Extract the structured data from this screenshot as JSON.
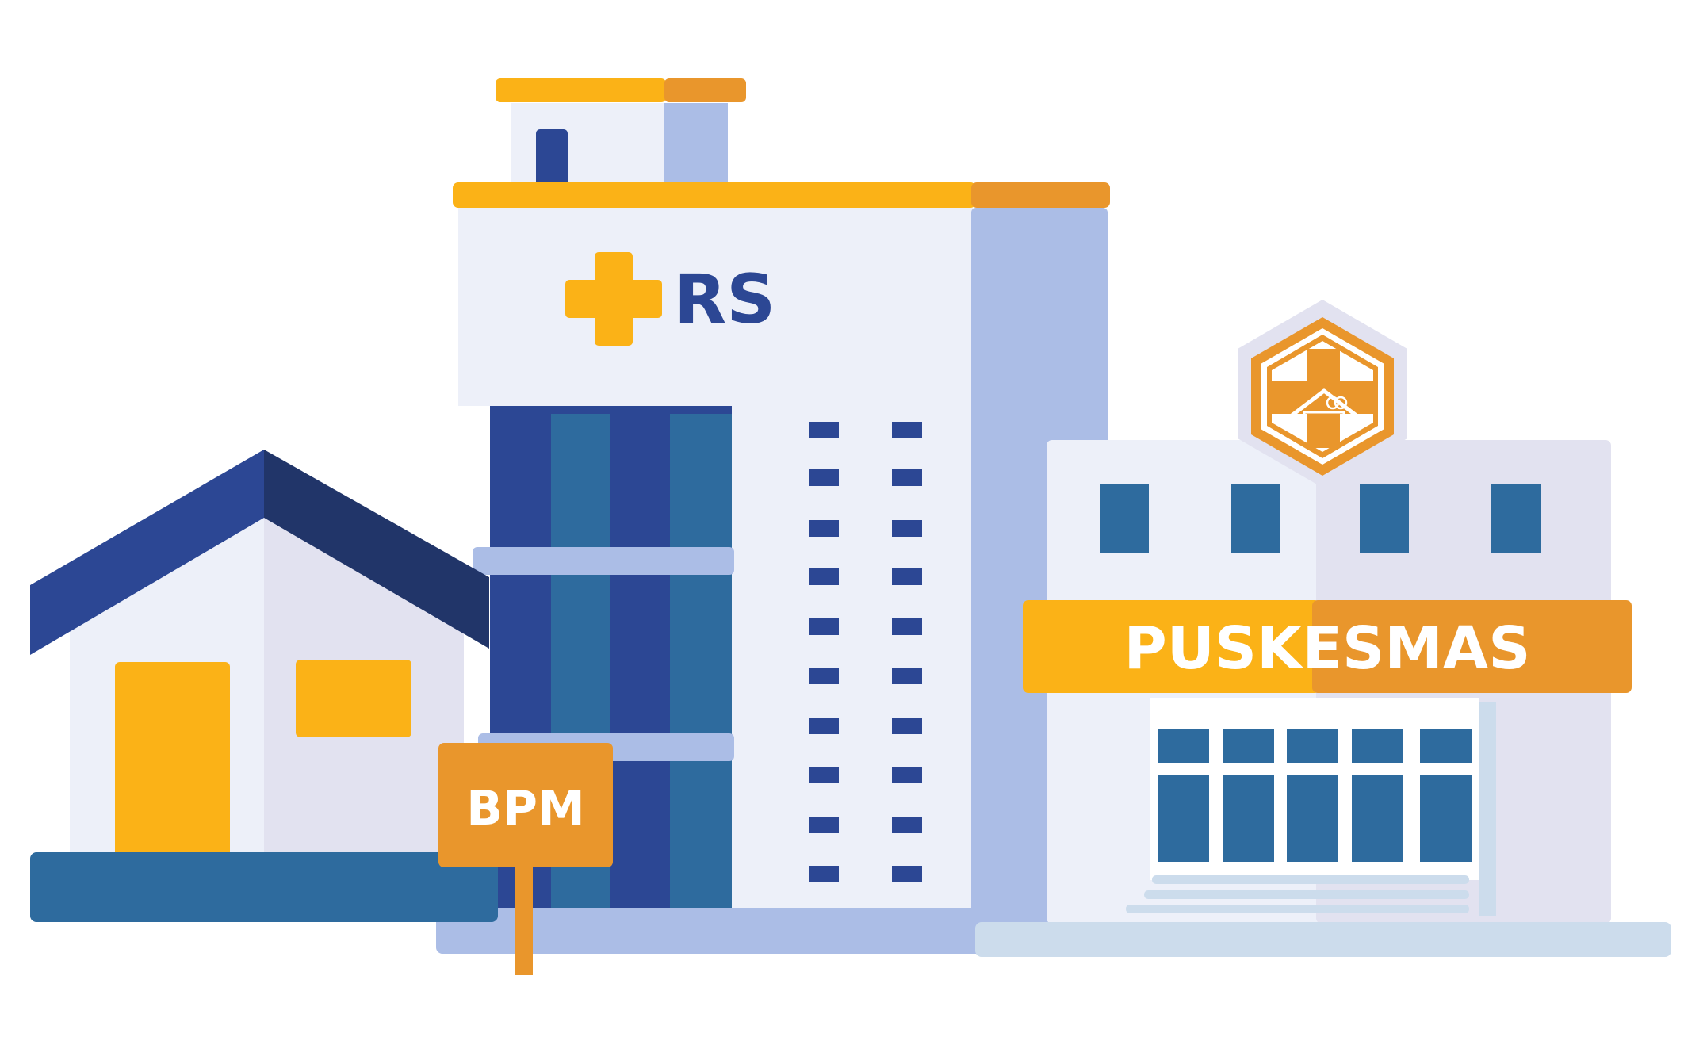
{
  "buildings": {
    "hospital": {
      "sign_text": "RS"
    },
    "clinic": {
      "sign_text": "PUSKESMAS"
    },
    "house": {
      "sign_text": "BPM"
    }
  },
  "colors": {
    "navy": "#2c4794",
    "navy_dark": "#213569",
    "teal": "#2e6b9e",
    "yellow": "#fbb217",
    "orange": "#e9962c",
    "light": "#edf0f9",
    "periwinkle": "#abbde6",
    "lavender": "#e2e2f0",
    "pale_blue": "#ccdcec"
  },
  "icons": {
    "hospital_cross": "cross-icon",
    "clinic_logo": "hexagon-cross-house-icon"
  }
}
